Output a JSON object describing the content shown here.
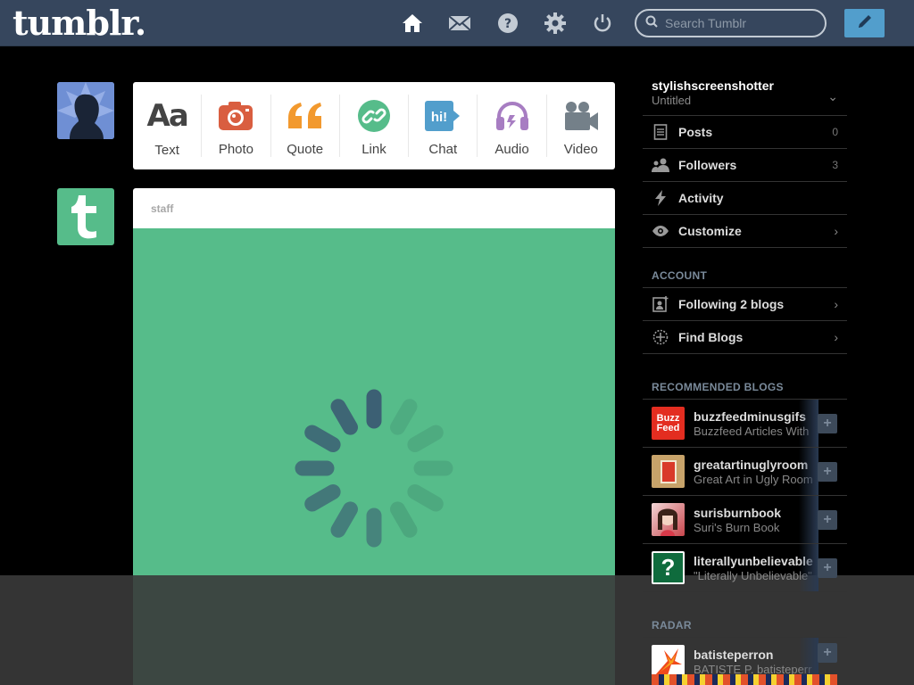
{
  "header": {
    "logo": "tumblr.",
    "nav": [
      "home-icon",
      "mail-icon",
      "help-icon",
      "gear-icon",
      "power-icon"
    ],
    "search_placeholder": "Search Tumblr",
    "compose": "pencil-icon"
  },
  "post_types": [
    {
      "label": "Text",
      "icon": "Aa",
      "color": "#444444"
    },
    {
      "label": "Photo",
      "icon": "camera-icon",
      "color": "#d95e40"
    },
    {
      "label": "Quote",
      "icon": "quote-icon",
      "color": "#f2992e"
    },
    {
      "label": "Link",
      "icon": "link-icon",
      "color": "#56bc8a"
    },
    {
      "label": "Chat",
      "icon": "hi!",
      "color": "#529ecc"
    },
    {
      "label": "Audio",
      "icon": "headphones-icon",
      "color": "#a77dc2"
    },
    {
      "label": "Video",
      "icon": "video-camera-icon",
      "color": "#748089"
    }
  ],
  "staff_post": {
    "author": "staff",
    "body_color": "#56bc8a"
  },
  "sidebar": {
    "blog_name": "stylishscreenshotter",
    "blog_sub": "Untitled",
    "items": [
      {
        "label": "Posts",
        "count": "0"
      },
      {
        "label": "Followers",
        "count": "3"
      },
      {
        "label": "Activity",
        "count": ""
      },
      {
        "label": "Customize",
        "count": ""
      }
    ],
    "account_heading": "ACCOUNT",
    "account_items": [
      {
        "label": "Following 2 blogs"
      },
      {
        "label": "Find Blogs"
      }
    ],
    "recommended_heading": "RECOMMENDED BLOGS",
    "recommended": [
      {
        "name": "buzzfeedminusgifs",
        "sub": "Buzzfeed Articles With",
        "thumb_text": "Buzz Feed"
      },
      {
        "name": "greatartinuglyroom",
        "sub": "Great Art in Ugly Room",
        "thumb_text": ""
      },
      {
        "name": "surisburnbook",
        "sub": "Suri's Burn Book",
        "thumb_text": ""
      },
      {
        "name": "literallyunbelievable",
        "sub": "\"Literally Unbelievable\"",
        "thumb_text": "?"
      }
    ],
    "radar_heading": "RADAR",
    "radar": [
      {
        "name": "batisteperron",
        "sub": "BATISTE P. batisteperr"
      }
    ]
  }
}
